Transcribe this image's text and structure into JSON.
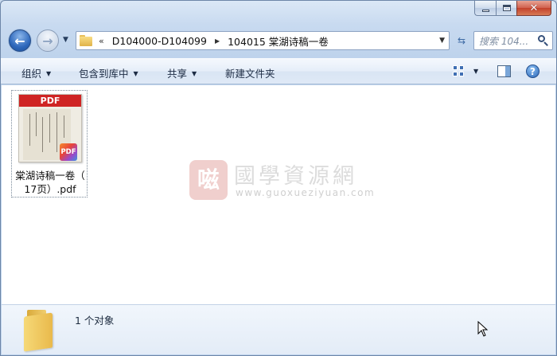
{
  "navigation": {
    "back_glyph": "←",
    "forward_glyph": "→",
    "breadcrumb": [
      "D104000-D104099",
      "104015 棠湖诗稿一卷"
    ],
    "search_placeholder": "搜索 104..."
  },
  "toolbar": {
    "organize": "组织",
    "include_in_library": "包含到库中",
    "share": "共享",
    "new_folder": "新建文件夹",
    "help": "?"
  },
  "files": [
    {
      "name_line1": "棠湖诗稿一卷（",
      "name_line2": "17页）.pdf",
      "thumb_banner": "PDF",
      "thumb_badge": "PDF"
    }
  ],
  "watermark": {
    "seal": "嗞",
    "title": "國學資源網",
    "url": "www.guoxueziyuan.com"
  },
  "details": {
    "item_count": "1 个对象"
  },
  "colors": {
    "pdf_red": "#cf2424",
    "accent_blue": "#2e68bc"
  }
}
